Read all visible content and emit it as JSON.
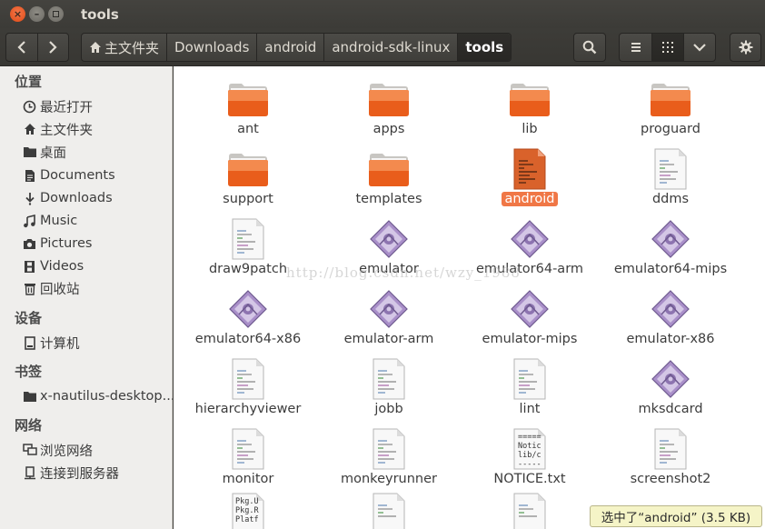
{
  "window": {
    "title": "tools"
  },
  "toolbar": {
    "back_icon": "chevron-left-icon",
    "forward_icon": "chevron-right-icon",
    "breadcrumbs": [
      "主文件夹",
      "Downloads",
      "android",
      "android-sdk-linux",
      "tools"
    ],
    "search_icon": "search-icon",
    "list_view_icon": "list-icon",
    "grid_view_icon": "grid-icon",
    "dropdown_icon": "chevron-down-icon",
    "settings_icon": "gear-icon"
  },
  "sidebar": {
    "sections": [
      {
        "title": "位置",
        "items": [
          {
            "label": "最近打开",
            "icon": "clock-icon"
          },
          {
            "label": "主文件夹",
            "icon": "home-icon"
          },
          {
            "label": "桌面",
            "icon": "folder-icon"
          },
          {
            "label": "Documents",
            "icon": "document-icon"
          },
          {
            "label": "Downloads",
            "icon": "download-icon"
          },
          {
            "label": "Music",
            "icon": "music-icon"
          },
          {
            "label": "Pictures",
            "icon": "camera-icon"
          },
          {
            "label": "Videos",
            "icon": "film-icon"
          },
          {
            "label": "回收站",
            "icon": "trash-icon"
          }
        ]
      },
      {
        "title": "设备",
        "items": [
          {
            "label": "计算机",
            "icon": "drive-icon"
          }
        ]
      },
      {
        "title": "书签",
        "items": [
          {
            "label": "x-nautilus-desktop...",
            "icon": "folder-icon"
          }
        ]
      },
      {
        "title": "网络",
        "items": [
          {
            "label": "浏览网络",
            "icon": "network-icon"
          },
          {
            "label": "连接到服务器",
            "icon": "server-icon"
          }
        ]
      }
    ]
  },
  "files": [
    {
      "name": "ant",
      "type": "folder"
    },
    {
      "name": "apps",
      "type": "folder"
    },
    {
      "name": "lib",
      "type": "folder"
    },
    {
      "name": "proguard",
      "type": "folder"
    },
    {
      "name": "support",
      "type": "folder"
    },
    {
      "name": "templates",
      "type": "folder"
    },
    {
      "name": "android",
      "type": "script-selected"
    },
    {
      "name": "ddms",
      "type": "script"
    },
    {
      "name": "draw9patch",
      "type": "script"
    },
    {
      "name": "emulator",
      "type": "executable"
    },
    {
      "name": "emulator64-arm",
      "type": "executable"
    },
    {
      "name": "emulator64-mips",
      "type": "executable"
    },
    {
      "name": "emulator64-x86",
      "type": "executable"
    },
    {
      "name": "emulator-arm",
      "type": "executable"
    },
    {
      "name": "emulator-mips",
      "type": "executable"
    },
    {
      "name": "emulator-x86",
      "type": "executable"
    },
    {
      "name": "hierarchyviewer",
      "type": "script"
    },
    {
      "name": "jobb",
      "type": "script"
    },
    {
      "name": "lint",
      "type": "script"
    },
    {
      "name": "mksdcard",
      "type": "executable"
    },
    {
      "name": "monitor",
      "type": "script"
    },
    {
      "name": "monkeyrunner",
      "type": "script"
    },
    {
      "name": "NOTICE.txt",
      "type": "text",
      "preview": [
        "=====",
        "Notic",
        "lib/c",
        "-----"
      ]
    },
    {
      "name": "screenshot2",
      "type": "script"
    },
    {
      "name": "",
      "type": "text",
      "preview": [
        "Pkg.U",
        "Pkg.R",
        "Platf"
      ]
    },
    {
      "name": "",
      "type": "script"
    },
    {
      "name": "",
      "type": "script"
    }
  ],
  "status": {
    "text": "选中了“android” (3.5 KB)"
  },
  "watermark": {
    "text": "http://blog.csdn.net/wzy_1988"
  },
  "colors": {
    "accent": "#f07746",
    "folder": "#e95d1b",
    "titlebar": "#3c3b37",
    "sidebar": "#efeeec"
  }
}
